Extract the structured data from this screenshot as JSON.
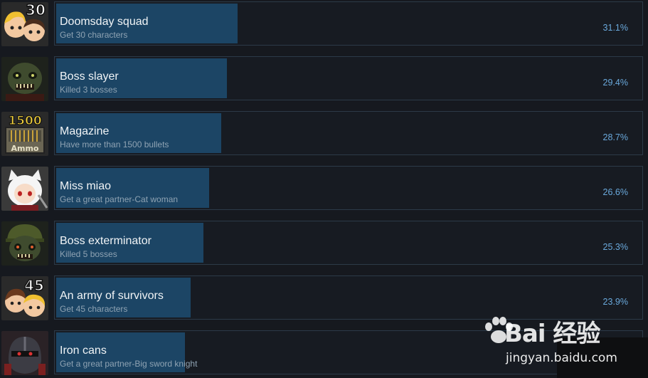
{
  "achievements": [
    {
      "title": "Doomsday squad",
      "description": "Get 30 characters",
      "percent": "31.1%",
      "icon": "survivor-duo-30-icon",
      "icon_badge": "30"
    },
    {
      "title": "Boss slayer",
      "description": "Killed 3 bosses",
      "percent": "29.4%",
      "icon": "zombie-boss-icon"
    },
    {
      "title": "Magazine",
      "description": "Have more than 1500 bullets",
      "percent": "28.7%",
      "icon": "ammo-crate-1500-icon",
      "icon_badge": "1500",
      "icon_sub": "Ammo"
    },
    {
      "title": "Miss miao",
      "description": "Get a great partner-Cat woman",
      "percent": "26.6%",
      "icon": "cat-woman-icon"
    },
    {
      "title": "Boss exterminator",
      "description": "Killed 5 bosses",
      "percent": "25.3%",
      "icon": "zombie-boss-helmet-icon"
    },
    {
      "title": "An army of survivors",
      "description": "Get 45 characters",
      "percent": "23.9%",
      "icon": "survivor-duo-45-icon",
      "icon_badge": "45"
    },
    {
      "title": "Iron cans",
      "description": "Get a great partner-Big sword knight",
      "percent": "",
      "icon": "armored-knight-icon"
    }
  ],
  "watermark": {
    "brand": "Bai 经验",
    "url": "jingyan.baidu.com"
  },
  "colors": {
    "background": "#16191f",
    "bar_fill": "#1c4565",
    "panel_border": "#2c3a48",
    "title": "#f1f4f6",
    "description": "#8fa3b3",
    "percent": "#6aa9dc"
  }
}
